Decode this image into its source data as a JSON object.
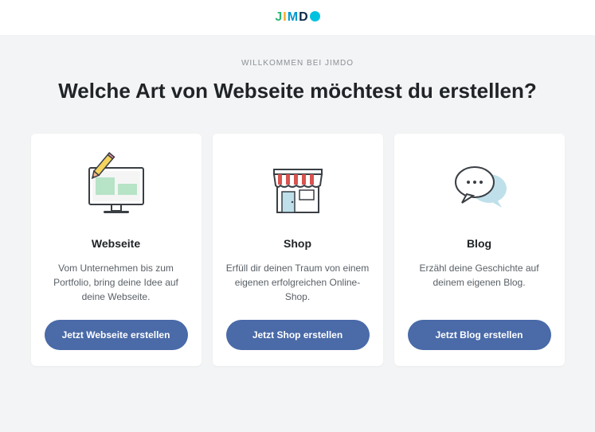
{
  "brand": "JIMDO",
  "kicker": "WILLKOMMEN BEI JIMDO",
  "title": "Welche Art von Webseite möchtest du erstellen?",
  "cards": [
    {
      "title": "Webseite",
      "desc": "Vom Unternehmen bis zum Portfolio, bring deine Idee auf deine Webseite.",
      "cta": "Jetzt Webseite erstellen"
    },
    {
      "title": "Shop",
      "desc": "Erfüll dir deinen Traum von einem eigenen erfolgreichen Online-Shop.",
      "cta": "Jetzt Shop erstellen"
    },
    {
      "title": "Blog",
      "desc": "Erzähl deine Geschichte auf deinem eigenen Blog.",
      "cta": "Jetzt Blog erstellen"
    }
  ]
}
